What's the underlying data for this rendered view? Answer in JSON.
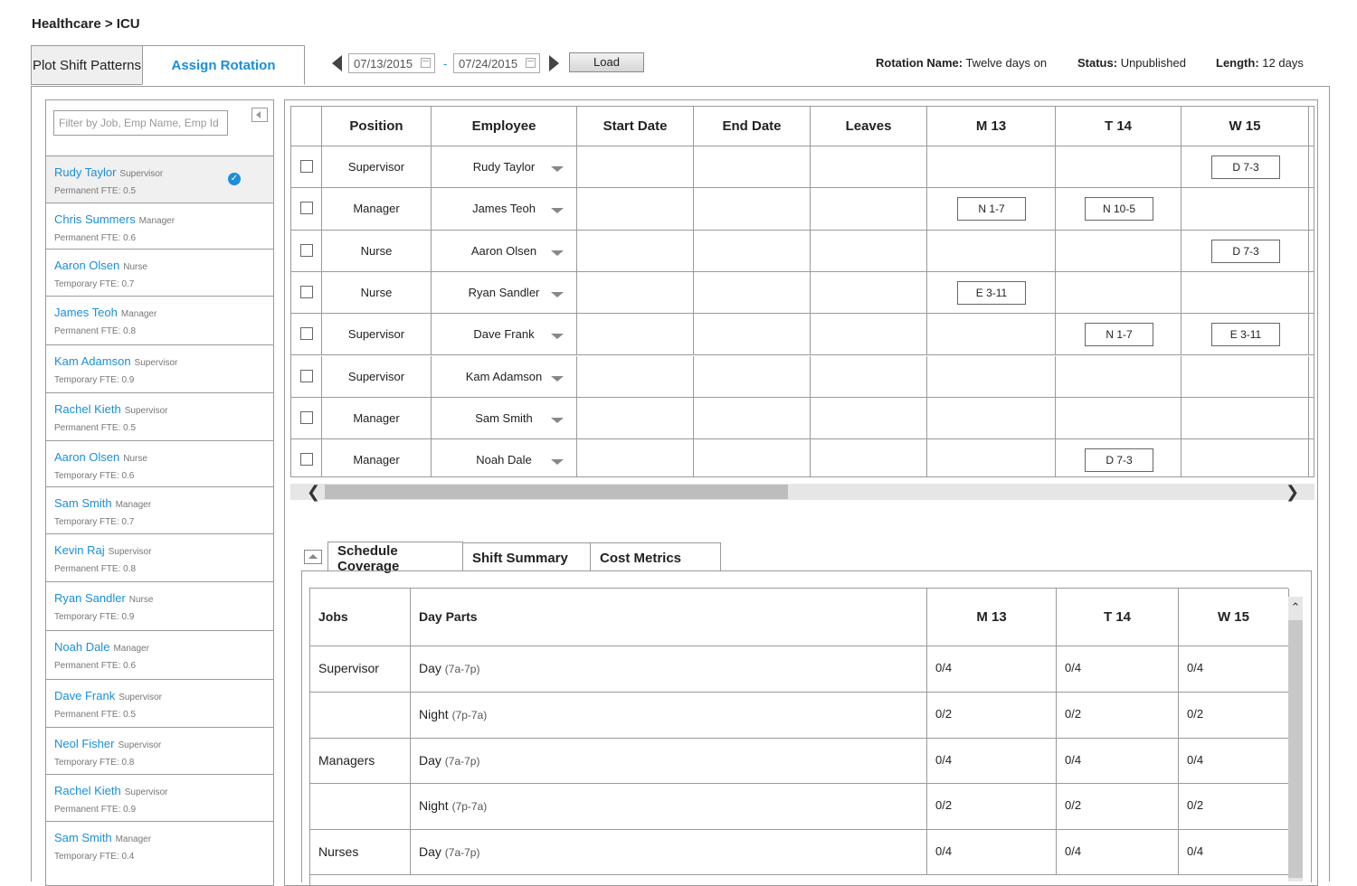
{
  "breadcrumb": "Healthcare > ICU",
  "tabs": {
    "plot": "Plot Shift Patterns",
    "assign": "Assign Rotation"
  },
  "dates": {
    "from": "07/13/2015",
    "sep": "-",
    "to": "07/24/2015"
  },
  "load_label": "Load",
  "meta": {
    "rotation_label": "Rotation Name:",
    "rotation_value": "Twelve days on",
    "status_label": "Status:",
    "status_value": "Unpublished",
    "length_label": "Length:",
    "length_value": "12 days"
  },
  "filter_placeholder": "Filter by Job, Emp Name, Emp Id",
  "employees": [
    {
      "name": "Rudy Taylor",
      "role": "Supervisor",
      "sub": "Permanent   FTE: 0.5",
      "selected": true
    },
    {
      "name": "Chris Summers",
      "role": "Manager",
      "sub": "Permanent   FTE: 0.6"
    },
    {
      "name": "Aaron Olsen",
      "role": "Nurse",
      "sub": "Temporary   FTE: 0.7"
    },
    {
      "name": "James Teoh",
      "role": "Manager",
      "sub": "Permanent   FTE: 0.8"
    },
    {
      "name": "Kam Adamson",
      "role": "Supervisor",
      "sub": "Temporary   FTE: 0.9"
    },
    {
      "name": "Rachel Kieth",
      "role": "Supervisor",
      "sub": "Permanent   FTE: 0.5"
    },
    {
      "name": "Aaron Olsen",
      "role": "Nurse",
      "sub": "Temporary   FTE: 0.6"
    },
    {
      "name": "Sam Smith",
      "role": "Manager",
      "sub": "Temporary   FTE: 0.7"
    },
    {
      "name": "Kevin Raj",
      "role": "Supervisor",
      "sub": "Permanent   FTE: 0.8"
    },
    {
      "name": "Ryan Sandler",
      "role": "Nurse",
      "sub": "Temporary   FTE: 0.9"
    },
    {
      "name": "Noah Dale",
      "role": "Manager",
      "sub": "Permanent   FTE: 0.6"
    },
    {
      "name": "Dave Frank",
      "role": "Supervisor",
      "sub": "Permanent   FTE: 0.5"
    },
    {
      "name": "Neol Fisher",
      "role": "Supervisor",
      "sub": "Temporary   FTE: 0.8"
    },
    {
      "name": "Rachel Kieth",
      "role": "Supervisor",
      "sub": "Permanent   FTE: 0.9"
    },
    {
      "name": "Sam Smith",
      "role": "Manager",
      "sub": "Temporary   FTE: 0.4"
    }
  ],
  "grid": {
    "headers": [
      "Position",
      "Employee",
      "Start Date",
      "End Date",
      "Leaves",
      "M 13",
      "T 14",
      "W 15"
    ],
    "rows": [
      {
        "position": "Supervisor",
        "employee": "Rudy Taylor",
        "shifts": [
          "",
          "",
          "D 7-3"
        ]
      },
      {
        "position": "Manager",
        "employee": "James Teoh",
        "shifts": [
          "N 1-7",
          "N 10-5",
          ""
        ]
      },
      {
        "position": "Nurse",
        "employee": "Aaron Olsen",
        "shifts": [
          "",
          "",
          "D 7-3"
        ]
      },
      {
        "position": "Nurse",
        "employee": "Ryan Sandler",
        "shifts": [
          "E 3-11",
          "",
          ""
        ]
      },
      {
        "position": "Supervisor",
        "employee": "Dave Frank",
        "shifts": [
          "",
          "N 1-7",
          "E 3-11"
        ]
      },
      {
        "position": "Supervisor",
        "employee": "Kam Adamson",
        "shifts": [
          "",
          "",
          ""
        ]
      },
      {
        "position": "Manager",
        "employee": "Sam Smith",
        "shifts": [
          "",
          "",
          ""
        ]
      },
      {
        "position": "Manager",
        "employee": "Noah Dale",
        "shifts": [
          "",
          "D 7-3",
          ""
        ]
      }
    ]
  },
  "bottom_tabs": [
    "Schedule Coverage",
    "Shift Summary",
    "Cost Metrics"
  ],
  "coverage": {
    "headers": [
      "Jobs",
      "Day Parts",
      "M 13",
      "T 14",
      "W 15"
    ],
    "rows": [
      {
        "job": "Supervisor",
        "part": "Day",
        "range": "(7a-7p)",
        "vals": [
          "0/4",
          "0/4",
          "0/4"
        ]
      },
      {
        "job": "",
        "part": "Night",
        "range": "(7p-7a)",
        "vals": [
          "0/2",
          "0/2",
          "0/2"
        ]
      },
      {
        "job": "Managers",
        "part": "Day",
        "range": "(7a-7p)",
        "vals": [
          "0/4",
          "0/4",
          "0/4"
        ]
      },
      {
        "job": "",
        "part": "Night",
        "range": "(7p-7a)",
        "vals": [
          "0/2",
          "0/2",
          "0/2"
        ]
      },
      {
        "job": "Nurses",
        "part": "Day",
        "range": "(7a-7p)",
        "vals": [
          "0/4",
          "0/4",
          "0/4"
        ]
      }
    ]
  }
}
